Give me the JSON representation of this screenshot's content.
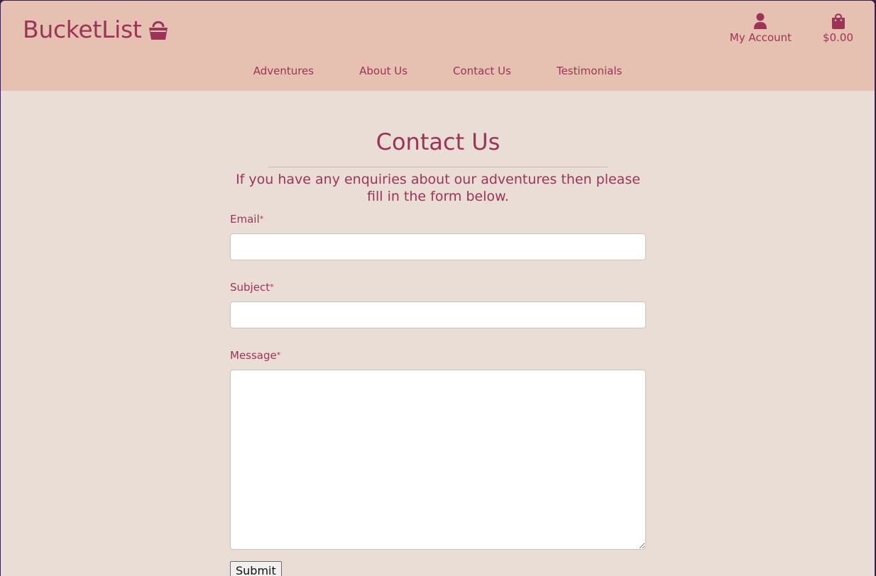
{
  "brand": {
    "name": "BucketList",
    "icon": "basket-icon"
  },
  "header": {
    "account": {
      "label": "My Account",
      "icon": "user-icon"
    },
    "cart": {
      "label": "$0.00",
      "icon": "shopping-bag-icon"
    }
  },
  "nav": {
    "items": [
      {
        "label": "Adventures"
      },
      {
        "label": "About Us"
      },
      {
        "label": "Contact Us"
      },
      {
        "label": "Testimonials"
      }
    ]
  },
  "page": {
    "title": "Contact Us",
    "intro": "If you have any enquiries about our adventures then please fill in the form below."
  },
  "form": {
    "email": {
      "label": "Email",
      "required_mark": "*",
      "value": ""
    },
    "subject": {
      "label": "Subject",
      "required_mark": "*",
      "value": ""
    },
    "message": {
      "label": "Message",
      "required_mark": "*",
      "value": ""
    },
    "submit_label": "Submit"
  },
  "colors": {
    "brand": "#9b3557",
    "header_bg": "#e6c0b0",
    "page_bg": "#eaddd6"
  }
}
